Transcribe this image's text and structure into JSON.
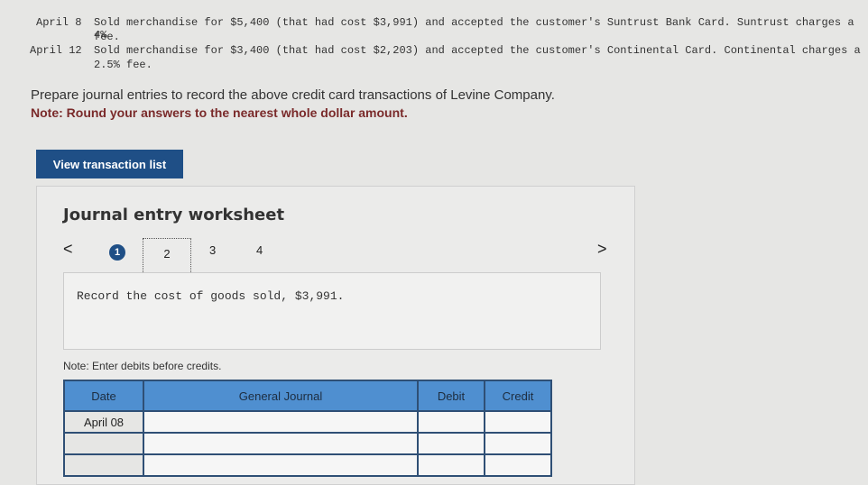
{
  "problem": {
    "rows": [
      {
        "date": "April 8",
        "text": "Sold merchandise for $5,400 (that had cost $3,991) and accepted the customer's Suntrust Bank Card. Suntrust charges a 4%",
        "cont": "fee."
      },
      {
        "date": "April 12",
        "text": "Sold merchandise for $3,400 (that had cost $2,203) and accepted the customer's Continental Card. Continental charges a",
        "cont": "2.5% fee."
      }
    ],
    "instruction": "Prepare journal entries to record the above credit card transactions of Levine Company.",
    "note": "Note: Round your answers to the nearest whole dollar amount."
  },
  "view_button": "View transaction list",
  "worksheet": {
    "title": "Journal entry worksheet",
    "tabs": [
      "1",
      "2",
      "3",
      "4"
    ],
    "prev": "<",
    "next": ">",
    "instruction": "Record the cost of goods sold, $3,991.",
    "note": "Note: Enter debits before credits.",
    "headers": [
      "Date",
      "General Journal",
      "Debit",
      "Credit"
    ],
    "rows": [
      {
        "date": "April 08"
      },
      {
        "date": ""
      },
      {
        "date": ""
      }
    ]
  }
}
